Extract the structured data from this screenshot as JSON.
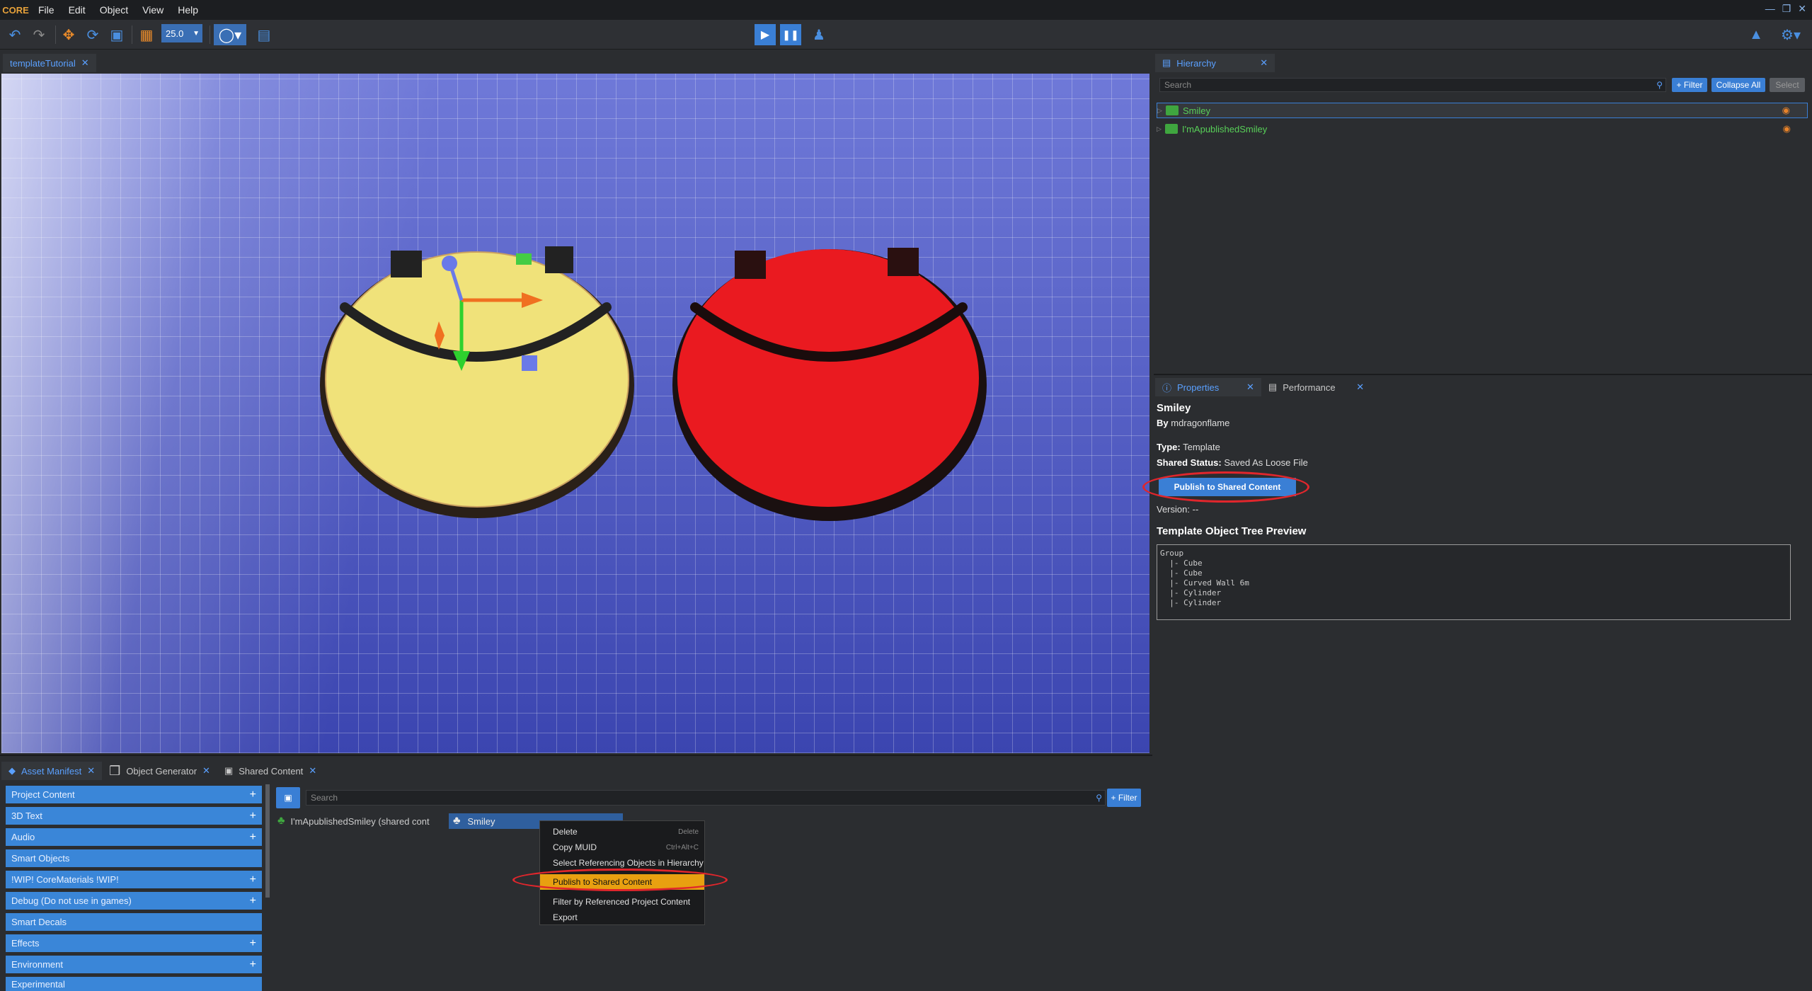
{
  "menubar": {
    "logo": "CORE",
    "items": [
      "File",
      "Edit",
      "Object",
      "View",
      "Help"
    ]
  },
  "toolbar": {
    "grid_size": "25.0"
  },
  "viewport_tab": {
    "label": "templateTutorial"
  },
  "hierarchy": {
    "tab_label": "Hierarchy",
    "search_placeholder": "Search",
    "filter_label": "+ Filter",
    "collapse_label": "Collapse All",
    "select_label": "Select",
    "items": [
      {
        "label": "Smiley"
      },
      {
        "label": "I'mApublishedSmiley"
      }
    ]
  },
  "properties": {
    "tab_label": "Properties",
    "perf_tab_label": "Performance",
    "name": "Smiley",
    "by_label": "By",
    "author": "mdragonflame",
    "type_label": "Type:",
    "type_value": "Template",
    "shared_label": "Shared Status:",
    "shared_value": "Saved As Loose File",
    "publish_label": "Publish to Shared Content",
    "version_label": "Version:",
    "version_value": "--",
    "tree_title": "Template Object Tree Preview",
    "tree_text": "Group\n  |- Cube\n  |- Cube\n  |- Curved Wall 6m\n  |- Cylinder\n  |- Cylinder"
  },
  "bottom_tabs": [
    "Asset Manifest",
    "Object Generator",
    "Shared Content"
  ],
  "asset_manifest": {
    "search_placeholder": "Search",
    "filter_label": "+ Filter",
    "categories": [
      {
        "label": "Project Content",
        "plus": true
      },
      {
        "label": "3D Text",
        "plus": true
      },
      {
        "label": "Audio",
        "plus": true
      },
      {
        "label": "Smart Objects",
        "plus": false
      },
      {
        "label": "!WIP! CoreMaterials !WIP!",
        "plus": true
      },
      {
        "label": "Debug (Do not use in games)",
        "plus": true
      },
      {
        "label": "Smart Decals",
        "plus": false
      },
      {
        "label": "Effects",
        "plus": true
      },
      {
        "label": "Environment",
        "plus": true
      },
      {
        "label": "Experimental",
        "plus": false
      }
    ],
    "items": [
      {
        "label": "I'mApublishedSmiley (shared cont"
      },
      {
        "label": "Smiley"
      }
    ]
  },
  "context_menu": {
    "items": [
      {
        "label": "Delete",
        "shortcut": "Delete"
      },
      {
        "label": "Copy MUID",
        "shortcut": "Ctrl+Alt+C"
      },
      {
        "label": "Select Referencing Objects in Hierarchy",
        "shortcut": ""
      },
      {
        "label": "Publish to Shared Content",
        "shortcut": ""
      },
      {
        "label": "Filter by Referenced Project Content",
        "shortcut": ""
      },
      {
        "label": "Export",
        "shortcut": ""
      }
    ]
  },
  "colors": {
    "accent": "#3a86d8",
    "highlight": "#e8a010",
    "annotation_ring": "#e0262c",
    "yellow_smiley": "#f0e27a",
    "red_smiley": "#ea1a20"
  }
}
